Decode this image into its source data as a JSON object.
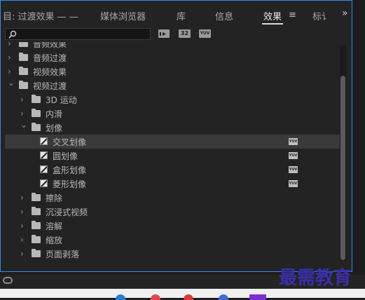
{
  "tabs": [
    {
      "label": "目: 过渡效果 — —",
      "active": false
    },
    {
      "label": "媒体浏览器",
      "active": false
    },
    {
      "label": "库",
      "active": false
    },
    {
      "label": "信息",
      "active": false
    },
    {
      "label": "效果",
      "active": true
    },
    {
      "label": "标讠",
      "active": false
    }
  ],
  "menu_glyph": "≡",
  "overflow_glyph": "»",
  "toolbar": {
    "search_value": "",
    "buttons": [
      "加速",
      "32",
      "YUV"
    ]
  },
  "tree": [
    {
      "label": "音频效果",
      "level": 0,
      "type": "folder",
      "expanded": false
    },
    {
      "label": "音频过渡",
      "level": 0,
      "type": "folder",
      "expanded": false
    },
    {
      "label": "视频效果",
      "level": 0,
      "type": "folder",
      "expanded": false
    },
    {
      "label": "视频过渡",
      "level": 0,
      "type": "folder",
      "expanded": true
    },
    {
      "label": "3D 运动",
      "level": 1,
      "type": "folder",
      "expanded": false
    },
    {
      "label": "内滑",
      "level": 1,
      "type": "folder",
      "expanded": false
    },
    {
      "label": "划像",
      "level": 1,
      "type": "folder",
      "expanded": true
    },
    {
      "label": "交叉划像",
      "level": 2,
      "type": "transition",
      "selected": true,
      "yuv": true
    },
    {
      "label": "圆划像",
      "level": 2,
      "type": "transition",
      "yuv": true
    },
    {
      "label": "盒形划像",
      "level": 2,
      "type": "transition",
      "yuv": true
    },
    {
      "label": "菱形划像",
      "level": 2,
      "type": "transition",
      "yuv": true
    },
    {
      "label": "擦除",
      "level": 1,
      "type": "folder",
      "expanded": false
    },
    {
      "label": "沉浸式视频",
      "level": 1,
      "type": "folder",
      "expanded": false
    },
    {
      "label": "溶解",
      "level": 1,
      "type": "folder",
      "expanded": false
    },
    {
      "label": "缩放",
      "level": 1,
      "type": "folder",
      "expanded": false
    },
    {
      "label": "页面剥落",
      "level": 1,
      "type": "folder",
      "expanded": false
    }
  ],
  "yuv_badge": "YUV",
  "watermark": "最需教育"
}
